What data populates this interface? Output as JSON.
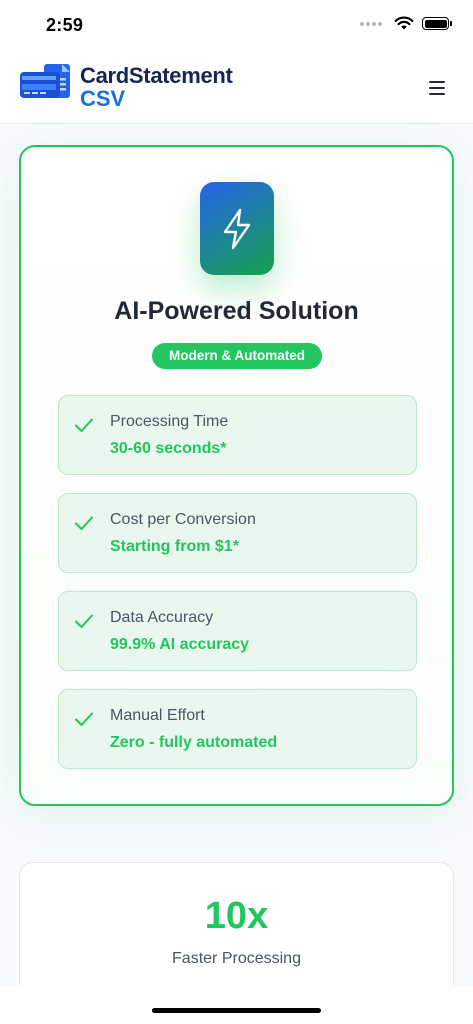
{
  "status_bar": {
    "time": "2:59",
    "icons": [
      "cellular-dots-icon",
      "wifi-icon",
      "battery-icon"
    ],
    "battery_level": 1.0
  },
  "header": {
    "brand_primary": "CardStatement",
    "brand_secondary": "CSV",
    "logo_icon": "credit-card-document-icon",
    "menu_icon": "hamburger-menu-icon"
  },
  "solution_card": {
    "icon": "lightning-bolt-icon",
    "title": "AI-Powered Solution",
    "badge": "Modern & Automated",
    "features": [
      {
        "label": "Processing Time",
        "value": "30-60 seconds*"
      },
      {
        "label": "Cost per Conversion",
        "value": "Starting from $1*"
      },
      {
        "label": "Data Accuracy",
        "value": "99.9% AI accuracy"
      },
      {
        "label": "Manual Effort",
        "value": "Zero - fully automated"
      }
    ]
  },
  "stat_card": {
    "value": "10x",
    "label": "Faster Processing"
  },
  "colors": {
    "accent_green": "#22c55e",
    "brand_navy": "#172554",
    "brand_blue": "#1d6fe0",
    "feature_bg": "#e9f7ee"
  }
}
